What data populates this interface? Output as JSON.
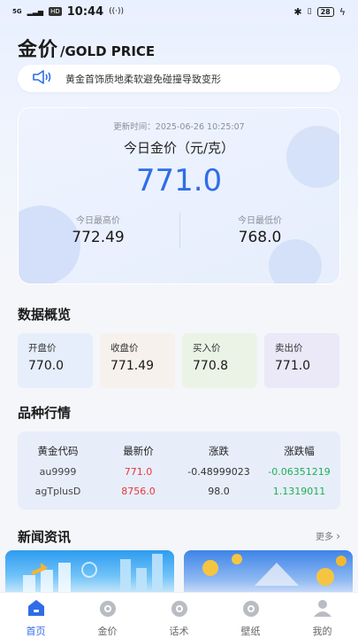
{
  "status_bar": {
    "signal": "5G",
    "hd": "HD",
    "time": "10:44",
    "battery": "28"
  },
  "header": {
    "title_cn": "金价",
    "title_en": "/GOLD PRICE"
  },
  "notice": {
    "text": "黄金首饰质地柔软避免碰撞导致变形"
  },
  "price_card": {
    "update_time": "更新时间：2025-06-26 10:25:07",
    "today_label": "今日金价（元/克）",
    "today_price": "771.0",
    "high_label": "今日最高价",
    "high_value": "772.49",
    "low_label": "今日最低价",
    "low_value": "768.0"
  },
  "overview": {
    "title": "数据概览",
    "items": [
      {
        "label": "开盘价",
        "value": "770.0"
      },
      {
        "label": "收盘价",
        "value": "771.49"
      },
      {
        "label": "买入价",
        "value": "770.8"
      },
      {
        "label": "卖出价",
        "value": "771.0"
      }
    ]
  },
  "market": {
    "title": "品种行情",
    "headers": [
      "黄金代码",
      "最新价",
      "涨跌",
      "涨跌幅"
    ],
    "rows": [
      [
        "au9999",
        "771.0",
        "-0.48999023",
        "-0.06351219"
      ],
      [
        "agTplusD",
        "8756.0",
        "98.0",
        "1.1319011"
      ]
    ]
  },
  "news": {
    "title": "新闻资讯",
    "more": "更多"
  },
  "tabs": [
    {
      "label": "首页",
      "icon": "home-icon"
    },
    {
      "label": "金价",
      "icon": "gold-price-icon"
    },
    {
      "label": "话术",
      "icon": "script-icon"
    },
    {
      "label": "壁纸",
      "icon": "wallpaper-icon"
    },
    {
      "label": "我的",
      "icon": "profile-icon"
    }
  ],
  "colors": {
    "accent": "#2f6de8",
    "red": "#e8343d",
    "green": "#1fae53"
  }
}
